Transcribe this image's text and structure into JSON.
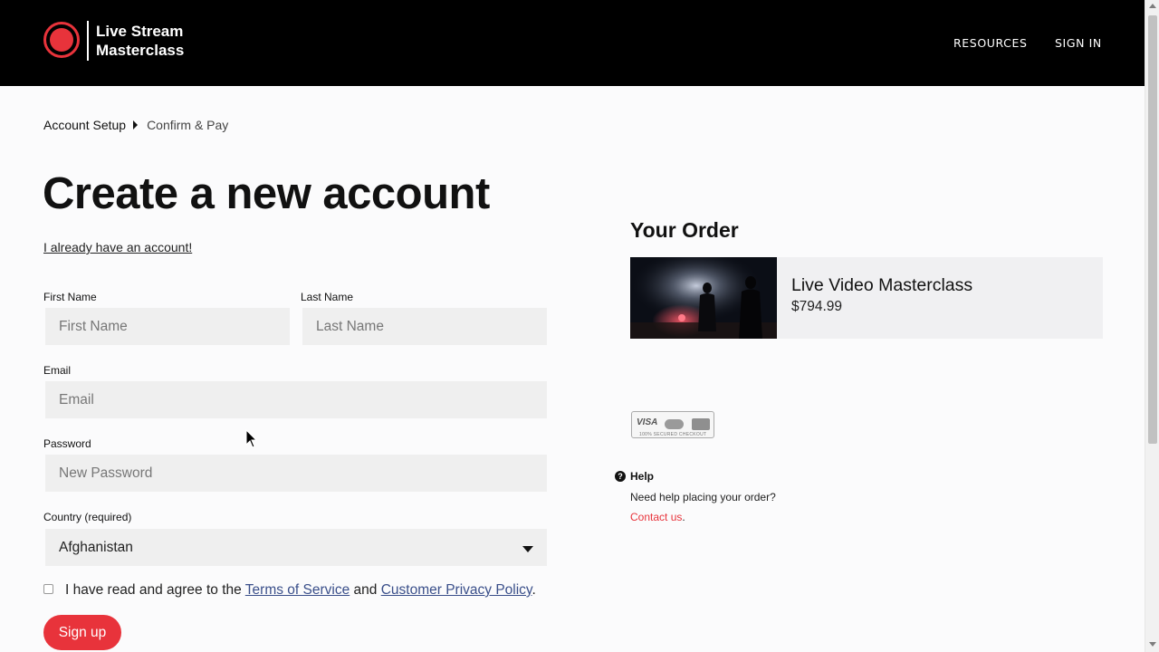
{
  "header": {
    "logo_line1": "Live Stream",
    "logo_line2": "Masterclass",
    "nav": [
      "RESOURCES",
      "SIGN IN"
    ]
  },
  "breadcrumb": [
    "Account Setup",
    "Confirm & Pay"
  ],
  "form": {
    "title": "Create a new account",
    "login_link": "I already have an account!",
    "first_name": {
      "label": "First Name",
      "placeholder": "First Name"
    },
    "last_name": {
      "label": "Last Name",
      "placeholder": "Last Name"
    },
    "email": {
      "label": "Email",
      "placeholder": "Email"
    },
    "password": {
      "label": "Password",
      "placeholder": "New Password"
    },
    "country": {
      "label": "Country (required)",
      "value": "Afghanistan"
    },
    "agree": {
      "prefix": "I have read and agree to the",
      "terms": "Terms of Service",
      "and": "and",
      "privacy": "Customer Privacy Policy",
      "suffix": ".",
      "checked": false
    },
    "submit_label": "Sign up"
  },
  "order": {
    "title": "Your Order",
    "item_name": "Live Video Masterclass",
    "item_price": "$794.99",
    "badge_visa": "VISA",
    "badge_secure": "100% SECURED CHECKOUT"
  },
  "help": {
    "title": "Help",
    "description": "Need help placing your order?",
    "contact_link": "Contact us",
    "contact_suffix": "."
  },
  "colors": {
    "accent": "#e8333b",
    "header_bg": "#000000",
    "field_bg": "#efefef",
    "link": "#3a4f8a"
  }
}
